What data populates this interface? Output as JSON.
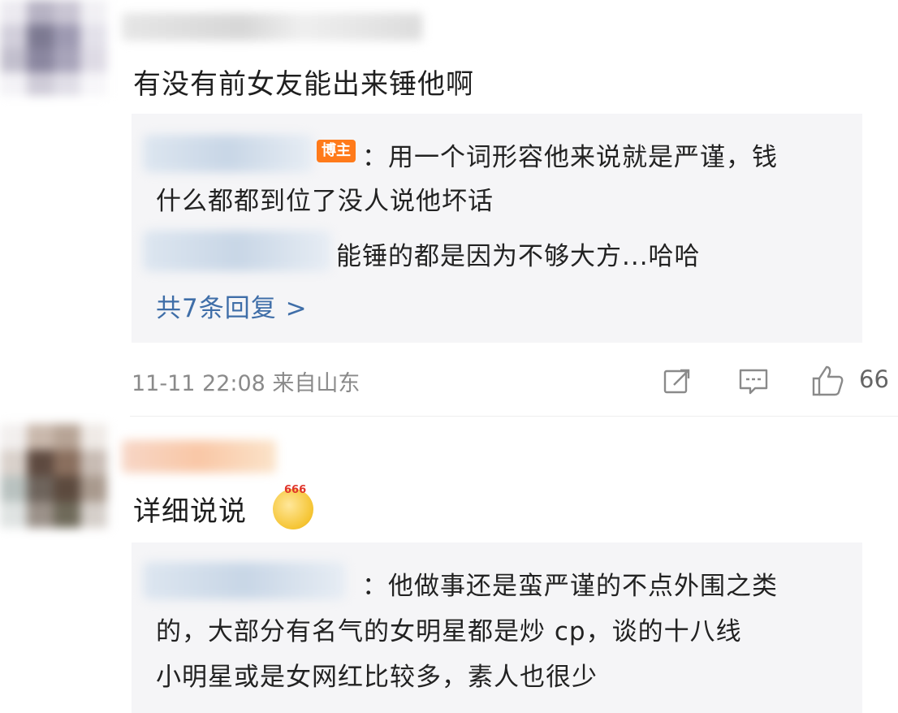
{
  "comments": [
    {
      "text": "有没有前女友能出来锤他啊",
      "replies": [
        {
          "badge": "博主",
          "text_line1": "：用一个词形容他来说就是严谨，钱",
          "text_line2": "什么都都到位了没人说他坏话"
        },
        {
          "text": "能锤的都是因为不够大方...哈哈"
        }
      ],
      "more_replies": "共7条回复 >",
      "meta": "11-11 22:08 来自山东",
      "likes": "66"
    },
    {
      "text": "详细说说",
      "emoji_label": "666",
      "replies": [
        {
          "text_line1": "：他做事还是蛮严谨的不点外围之类",
          "text_line2": "的，大部分有名气的女明星都是炒 cp，谈的十八线",
          "text_line3": "小明星或是女网红比较多，素人也很少"
        }
      ]
    }
  ],
  "icons": [
    "share-icon",
    "comment-icon",
    "like-icon"
  ],
  "colors": {
    "link": "#3f6ea8",
    "badge": "#ff7a1a",
    "reply_bg": "#f5f5f7",
    "meta": "#8a8a8a"
  }
}
